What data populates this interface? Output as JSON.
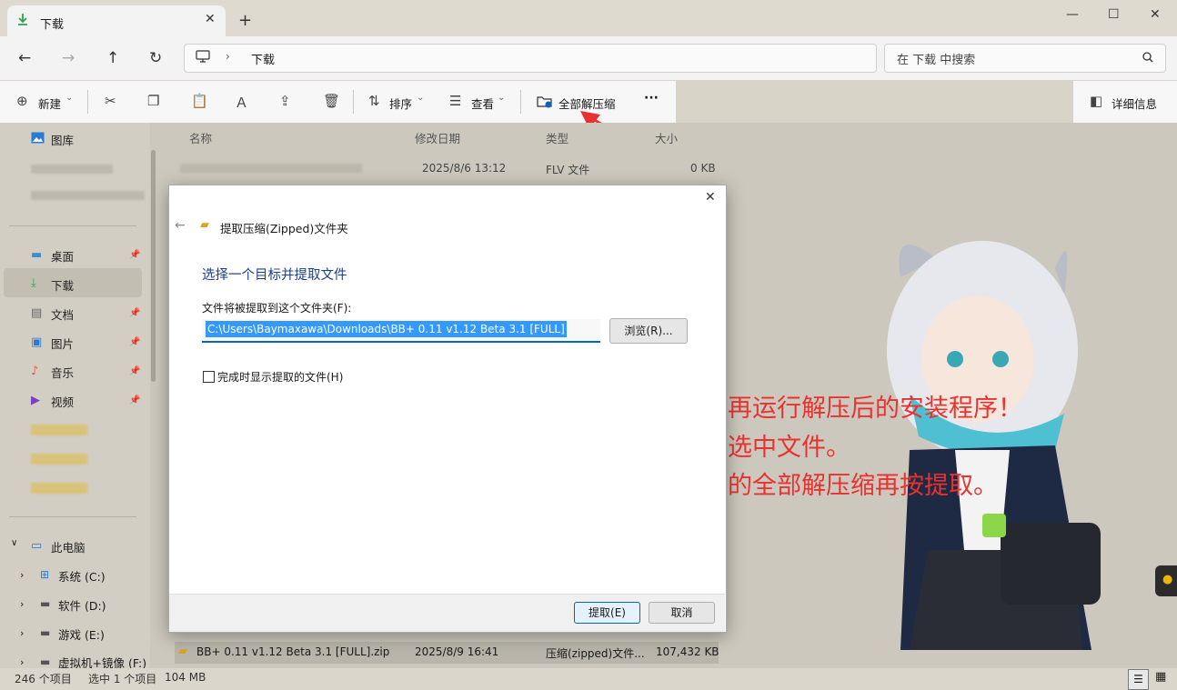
{
  "window": {
    "tab_title": "下载",
    "tab_close": "✕",
    "new_tab": "+",
    "minimize": "—",
    "maximize": "☐",
    "close": "✕"
  },
  "address_bar": {
    "crumb_sep": "›",
    "location": "下载",
    "search_placeholder": "在 下载 中搜索"
  },
  "toolbar": {
    "new_label": "新建",
    "sort_label": "排序",
    "view_label": "查看",
    "extract_all_label": "全部解压缩",
    "more_label": "···",
    "details_label": "详细信息",
    "dropdown_caret": "⌄"
  },
  "columns": {
    "name": "名称",
    "date": "修改日期",
    "type": "类型",
    "size": "大小"
  },
  "files": [
    {
      "date": "2025/8/6 13:12",
      "type": "FLV 文件",
      "size": "0 KB"
    },
    {
      "name": "BB+ 0.11 v1.12 Beta 3.1 [FULL].zip",
      "date": "2025/8/9 16:41",
      "type": "压缩(zipped)文件...",
      "size": "107,432 KB"
    }
  ],
  "sidebar": {
    "gallery": "图库",
    "quick": [
      "桌面",
      "下载",
      "文档",
      "图片",
      "音乐",
      "视频"
    ],
    "this_pc": "此电脑",
    "drives": [
      "系统 (C:)",
      "软件 (D:)",
      "游戏 (E:)",
      "虚拟机+镜像 (F:)"
    ]
  },
  "status": {
    "count": "246 个项目",
    "selected": "选中 1 个项目",
    "size": "104 MB"
  },
  "dialog": {
    "title": "提取压缩(Zipped)文件夹",
    "heading": "选择一个目标并提取文件",
    "dest_label": "文件将被提取到这个文件夹(F):",
    "path": "C:\\Users\\Baymaxawa\\Downloads\\BB+ 0.11 v1.12 Beta 3.1 [FULL]",
    "browse": "浏览(R)...",
    "checkbox_label": "完成时显示提取的文件(H)",
    "extract": "提取(E)",
    "cancel": "取消"
  },
  "annotations": [
    "一定要先解压再运行解压后的安装程序！",
    "解压方法就是选中文件。",
    "然后先按上面的全部解压缩再按提取。"
  ],
  "colors": {
    "accent": "#0067c0",
    "annotation_red": "#e8322f",
    "download_green": "#2da44e"
  }
}
